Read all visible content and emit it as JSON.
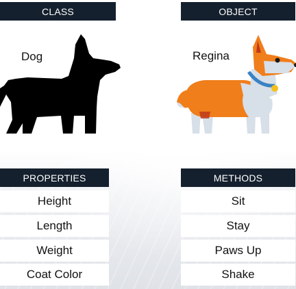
{
  "class_panel": {
    "header": "CLASS",
    "name": "Dog",
    "icon": "dog-silhouette-icon"
  },
  "object_panel": {
    "header": "OBJECT",
    "name": "Regina",
    "icon": "corgi-icon"
  },
  "properties": {
    "header": "PROPERTIES",
    "items": [
      "Height",
      "Length",
      "Weight",
      "Coat Color"
    ]
  },
  "methods": {
    "header": "METHODS",
    "items": [
      "Sit",
      "Stay",
      "Paws Up",
      "Shake"
    ]
  },
  "colors": {
    "header_bg": "#15202e",
    "corgi_orange": "#f07e1a",
    "corgi_gray": "#d7dfe8",
    "collar_blue": "#3b82c4",
    "tag_gold": "#f2c01e"
  }
}
